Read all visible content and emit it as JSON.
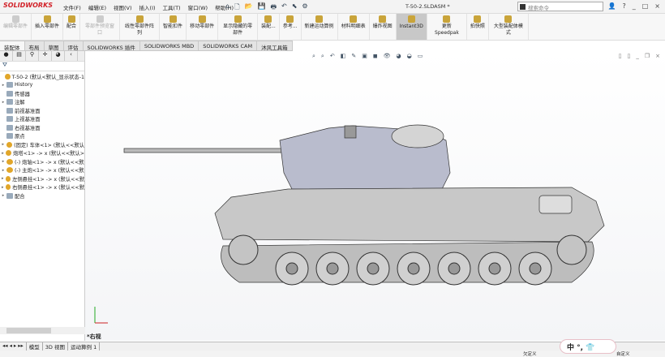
{
  "app": {
    "logo": "SOLIDWORKS",
    "title": "T-50-2.SLDASM *",
    "search_placeholder": "搜索命令"
  },
  "menu": [
    "文件(F)",
    "编辑(E)",
    "视图(V)",
    "插入(I)",
    "工具(T)",
    "窗口(W)",
    "帮助(H)"
  ],
  "ribbon": [
    {
      "label": "编辑零部件",
      "disabled": true
    },
    {
      "label": "插入零部件",
      "disabled": false
    },
    {
      "label": "配合",
      "disabled": false
    },
    {
      "label": "零部件预览窗口",
      "disabled": true
    },
    {
      "label": "线性零部件阵列",
      "disabled": false
    },
    {
      "label": "智能扣件",
      "disabled": false
    },
    {
      "label": "移动零部件",
      "disabled": false
    },
    {
      "label": "显示隐藏的零部件",
      "disabled": false
    },
    {
      "label": "装配...",
      "disabled": false
    },
    {
      "label": "参考...",
      "disabled": false
    },
    {
      "label": "新建运动算例",
      "disabled": false
    },
    {
      "label": "材料明细表",
      "disabled": false
    },
    {
      "label": "爆炸视图",
      "disabled": false
    },
    {
      "label": "Instant3D",
      "disabled": false,
      "active": true
    },
    {
      "label": "更新Speedpak",
      "disabled": false
    },
    {
      "label": "拍快照",
      "disabled": false
    },
    {
      "label": "大型装配体模式",
      "disabled": false
    }
  ],
  "tabs": [
    "装配体",
    "布局",
    "草图",
    "评估",
    "SOLIDWORKS 插件",
    "SOLIDWORKS MBD",
    "SOLIDWORKS CAM",
    "沐风工具箱"
  ],
  "tree": [
    {
      "label": "T-50-2  (默认<默认_显示状态-1",
      "arrow": false,
      "icon": "assembly"
    },
    {
      "label": "History",
      "arrow": true,
      "icon": "folder"
    },
    {
      "label": "传感器",
      "arrow": false,
      "icon": "folder"
    },
    {
      "label": "注解",
      "arrow": true,
      "icon": "folder"
    },
    {
      "label": "前视基准面",
      "arrow": false,
      "icon": "plane"
    },
    {
      "label": "上视基准面",
      "arrow": false,
      "icon": "plane"
    },
    {
      "label": "右视基准面",
      "arrow": false,
      "icon": "plane"
    },
    {
      "label": "原点",
      "arrow": false,
      "icon": "origin"
    },
    {
      "label": "(固定) 车体<1> (默认<<默认",
      "arrow": true,
      "icon": "assembly"
    },
    {
      "label": "炮塔<1> -> x (默认<<默认>",
      "arrow": true,
      "icon": "assembly"
    },
    {
      "label": "(-) 炮轴<1> -> x (默认<<默",
      "arrow": true,
      "icon": "assembly"
    },
    {
      "label": "(-) 主炮<1> -> x (默认<<默",
      "arrow": true,
      "icon": "assembly"
    },
    {
      "label": "左侧悬挂<1> -> x (默认<<默",
      "arrow": true,
      "icon": "assembly"
    },
    {
      "label": "右侧悬挂<1> -> x (默认<<默",
      "arrow": true,
      "icon": "assembly"
    },
    {
      "label": "配合",
      "arrow": true,
      "icon": "mates"
    }
  ],
  "view": {
    "label": "*右视"
  },
  "bottom_tabs": [
    "模型",
    "3D 视图",
    "运动算例 1"
  ],
  "status": {
    "left": "欠定义",
    "right": "自定义"
  },
  "ime": {
    "text": "中 °, 👕"
  },
  "colors": {
    "accent": "#d2232a",
    "model": "#c8c8c8",
    "model_edge": "#333333"
  }
}
